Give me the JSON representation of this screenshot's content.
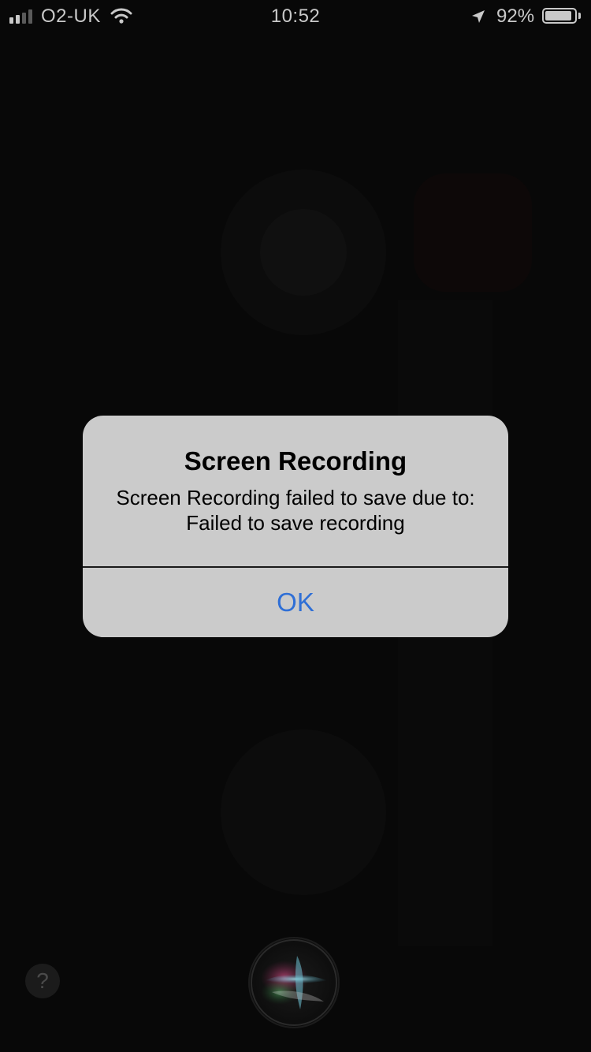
{
  "status_bar": {
    "carrier": "O2-UK",
    "time": "10:52",
    "battery_percent_label": "92%",
    "battery_level": 0.92,
    "signal_bars_filled": 2,
    "signal_bars_total": 4,
    "icons": [
      "signal-icon",
      "wifi-icon",
      "location-arrow-icon",
      "battery-icon"
    ]
  },
  "alert": {
    "title": "Screen Recording",
    "message_line1": "Screen Recording failed to save due to:",
    "message_line2": "Failed to save recording",
    "ok_label": "OK"
  },
  "bottom": {
    "help_label": "?",
    "icons": [
      "help-icon",
      "siri-icon"
    ]
  },
  "colors": {
    "alert_background": "#cbcbcb",
    "button_blue": "#2f6fd6",
    "screen_background": "#080808"
  }
}
